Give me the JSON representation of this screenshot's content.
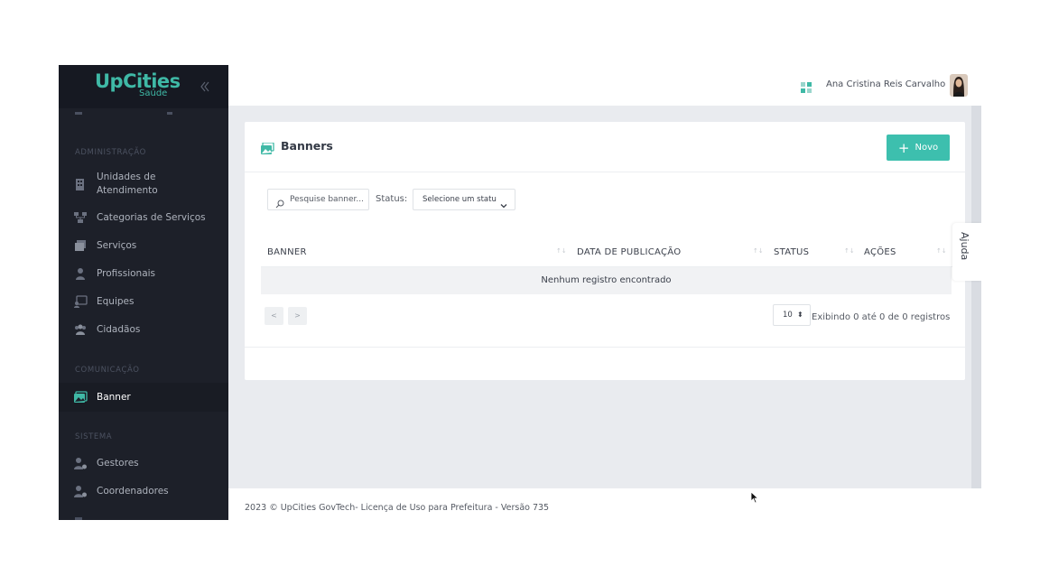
{
  "brand": {
    "logo_main": "UpCities",
    "logo_sub": "Saúde",
    "accent_color": "#3fb9a6"
  },
  "sidebar": {
    "sections": [
      {
        "title": "ADMINISTRAÇÃO"
      },
      {
        "title": "COMUNICAÇÃO"
      },
      {
        "title": "SISTEMA"
      }
    ],
    "items": [
      {
        "label": "Unidades de Atendimento",
        "icon": "building-icon"
      },
      {
        "label": "Categorias de Serviços",
        "icon": "hierarchy-icon"
      },
      {
        "label": "Serviços",
        "icon": "stack-icon"
      },
      {
        "label": "Profissionais",
        "icon": "person-icon"
      },
      {
        "label": "Equipes",
        "icon": "team-icon"
      },
      {
        "label": "Cidadãos",
        "icon": "people-icon"
      },
      {
        "label": "Banner",
        "icon": "image-icon",
        "active": true
      },
      {
        "label": "Gestores",
        "icon": "user-gear-icon"
      },
      {
        "label": "Coordenadores",
        "icon": "user-gear-icon"
      }
    ]
  },
  "header": {
    "user_name": "Ana Cristina Reis Carvalho"
  },
  "page": {
    "title": "Banners",
    "new_button": "Novo",
    "search_placeholder": "Pesquise banner...",
    "status_label": "Status:",
    "status_select": "Selecione um status",
    "table": {
      "columns": [
        "BANNER",
        "DATA DE PUBLICAÇÃO",
        "STATUS",
        "AÇÕES"
      ],
      "sort_glyph": "↑↓",
      "empty_message": "Nenhum registro encontrado"
    },
    "pagination": {
      "prev": "<",
      "next": ">",
      "per_page": "10",
      "showing": "Exibindo 0 até 0 de 0 registros"
    }
  },
  "help_tab": "Ajuda",
  "footer": {
    "text": "2023 © UpCities GovTech- Licença de Uso para Prefeitura - Versão 735"
  }
}
